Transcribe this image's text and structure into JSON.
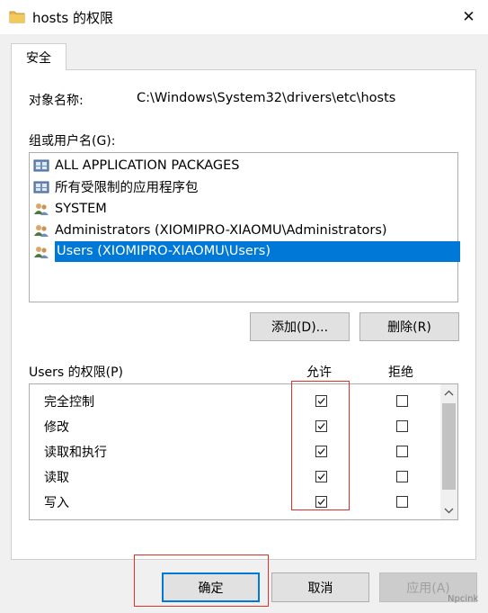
{
  "window": {
    "title": "hosts 的权限",
    "close_glyph": "✕"
  },
  "tabs": [
    {
      "label": "安全"
    }
  ],
  "object": {
    "label": "对象名称:",
    "value": "C:\\Windows\\System32\\drivers\\etc\\hosts"
  },
  "groups": {
    "label": "组或用户名(G):",
    "items": [
      {
        "label": "ALL APPLICATION PACKAGES",
        "icon": "package-group-icon",
        "selected": false
      },
      {
        "label": "所有受限制的应用程序包",
        "icon": "package-group-icon",
        "selected": false
      },
      {
        "label": "SYSTEM",
        "icon": "users-group-icon",
        "selected": false
      },
      {
        "label": "Administrators (XIOMIPRO-XIAOMU\\Administrators)",
        "icon": "users-group-icon",
        "selected": false
      },
      {
        "label": "Users (XIOMIPRO-XIAOMU\\Users)",
        "icon": "users-group-icon",
        "selected": true
      }
    ]
  },
  "buttons": {
    "add": "添加(D)...",
    "remove": "删除(R)",
    "ok": "确定",
    "cancel": "取消",
    "apply": "应用(A)"
  },
  "permissions": {
    "label": "Users 的权限(P)",
    "allow_header": "允许",
    "deny_header": "拒绝",
    "rows": [
      {
        "name": "完全控制",
        "allow": true,
        "deny": false
      },
      {
        "name": "修改",
        "allow": true,
        "deny": false
      },
      {
        "name": "读取和执行",
        "allow": true,
        "deny": false
      },
      {
        "name": "读取",
        "allow": true,
        "deny": false
      },
      {
        "name": "写入",
        "allow": true,
        "deny": false
      }
    ]
  },
  "colors": {
    "selection": "#0078d7",
    "annotation": "#e0302a",
    "folder": "#e8b84a"
  },
  "watermark": "Npcink"
}
